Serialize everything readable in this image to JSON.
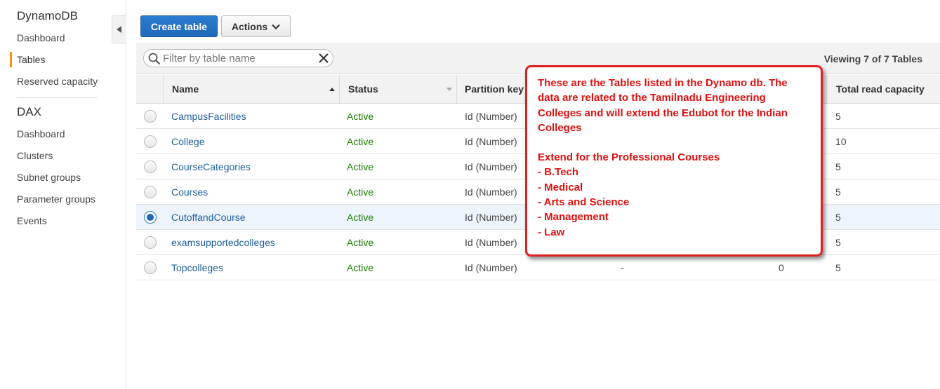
{
  "sidebar": {
    "heading1": "DynamoDB",
    "items1": [
      {
        "label": "Dashboard"
      },
      {
        "label": "Tables",
        "active": true
      },
      {
        "label": "Reserved capacity"
      }
    ],
    "heading2": "DAX",
    "items2": [
      {
        "label": "Dashboard"
      },
      {
        "label": "Clusters"
      },
      {
        "label": "Subnet groups"
      },
      {
        "label": "Parameter groups"
      },
      {
        "label": "Events"
      }
    ]
  },
  "toolbar": {
    "create_label": "Create table",
    "actions_label": "Actions"
  },
  "filter": {
    "placeholder": "Filter by table name",
    "value": "",
    "viewing": "Viewing 7 of 7 Tables"
  },
  "table": {
    "columns": {
      "name": "Name",
      "status": "Status",
      "partition_key": "Partition key",
      "total_read": "Total read capacity"
    },
    "rows": [
      {
        "name": "CampusFacilities",
        "status": "Active",
        "partition_key": "Id (Number)",
        "sort_key": "",
        "indexes": "",
        "total_read": "5"
      },
      {
        "name": "College",
        "status": "Active",
        "partition_key": "Id (Number)",
        "sort_key": "",
        "indexes": "",
        "total_read": "10"
      },
      {
        "name": "CourseCategories",
        "status": "Active",
        "partition_key": "Id (Number)",
        "sort_key": "",
        "indexes": "",
        "total_read": "5"
      },
      {
        "name": "Courses",
        "status": "Active",
        "partition_key": "Id (Number)",
        "sort_key": "",
        "indexes": "",
        "total_read": "5"
      },
      {
        "name": "CutoffandCourse",
        "status": "Active",
        "partition_key": "Id (Number)",
        "sort_key": "",
        "indexes": "",
        "total_read": "5",
        "selected": true
      },
      {
        "name": "examsupportedcolleges",
        "status": "Active",
        "partition_key": "Id (Number)",
        "sort_key": "",
        "indexes": "",
        "total_read": "5"
      },
      {
        "name": "Topcolleges",
        "status": "Active",
        "partition_key": "Id (Number)",
        "sort_key": "-",
        "indexes": "0",
        "total_read": "5"
      }
    ]
  },
  "annotation": {
    "intro": "These are the Tables listed in the Dynamo db. The data are related to the Tamilnadu Engineering Colleges and will extend the  Edubot  for the Indian Colleges",
    "extend_heading": "Extend for the Professional Courses",
    "courses": [
      "- B.Tech",
      "- Medical",
      "- Arts and Science",
      "- Management",
      "- Law"
    ]
  },
  "colors": {
    "primary": "#1f68b8",
    "active_status": "#1d8102",
    "link": "#1f5f9e",
    "sidebar_accent": "#f89406",
    "annotation": "#e01010"
  }
}
